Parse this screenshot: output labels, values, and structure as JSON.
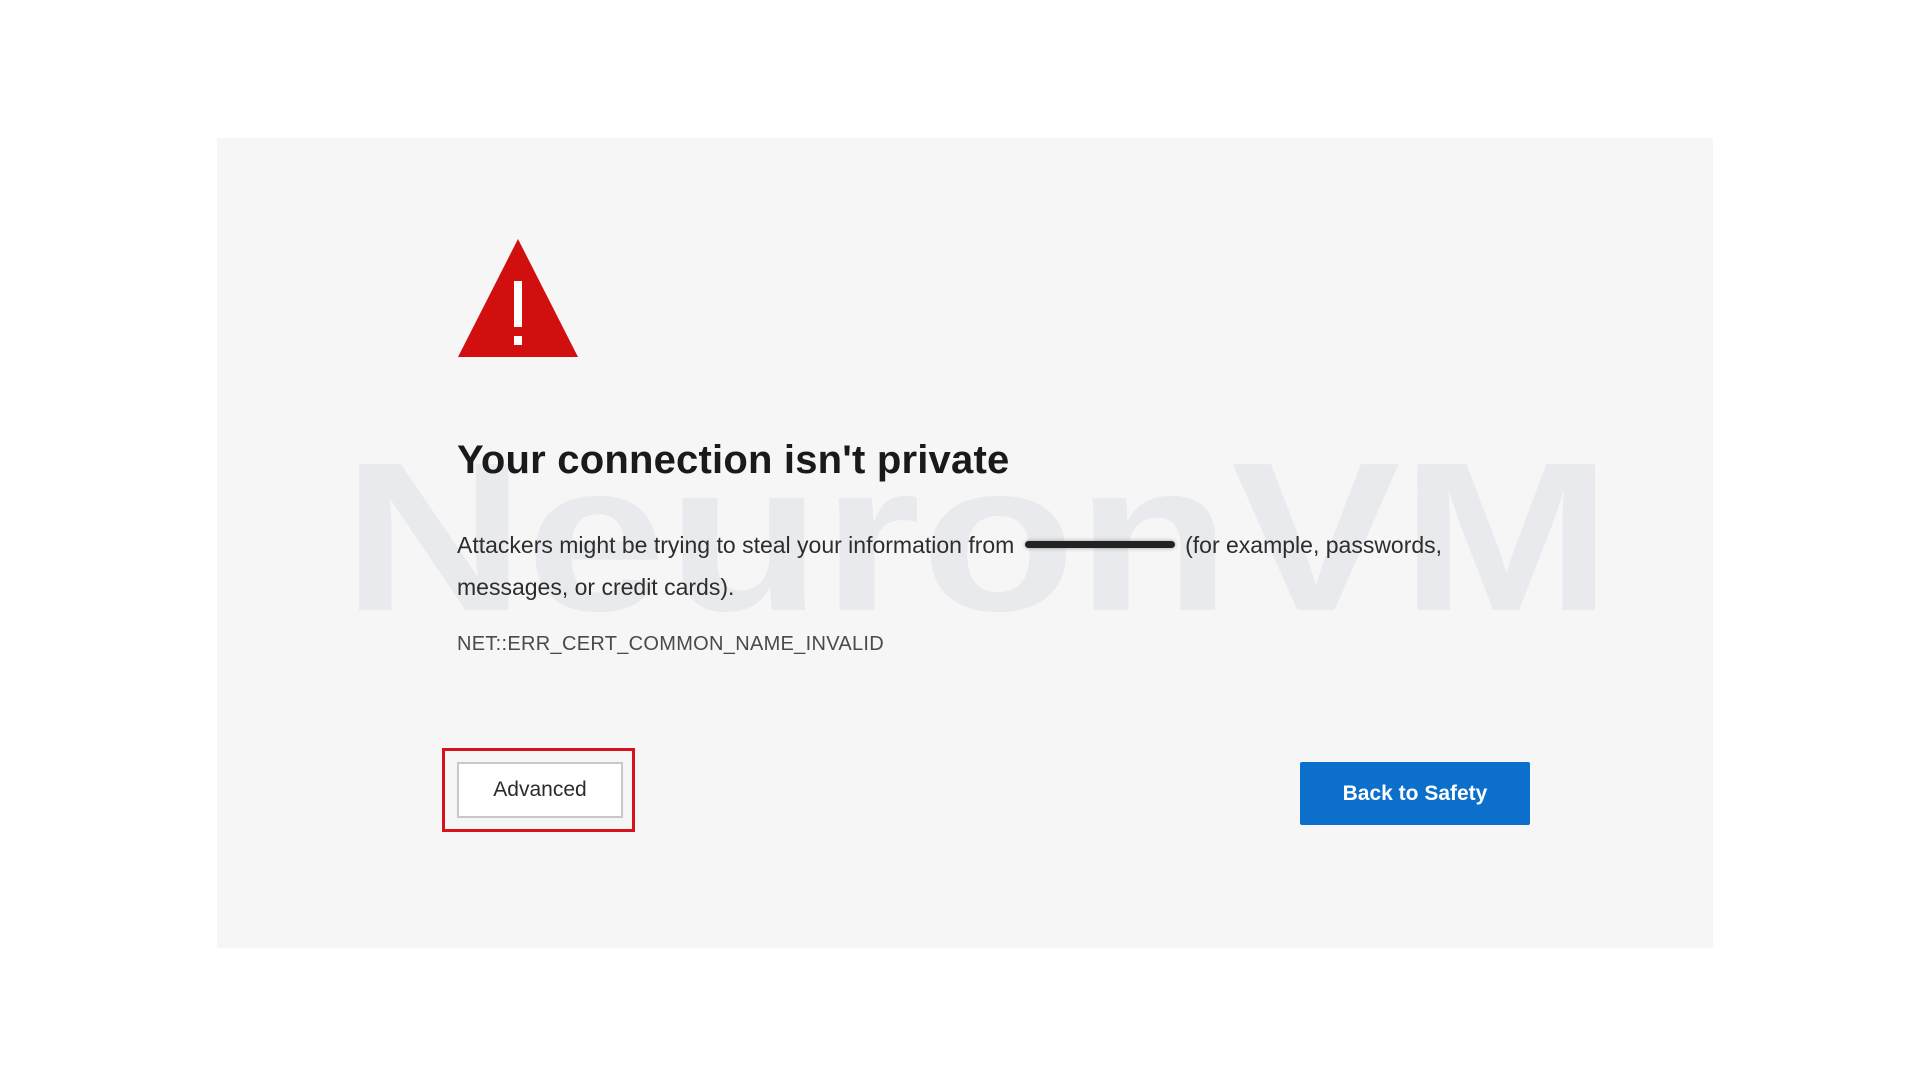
{
  "page": {
    "title": "Your connection isn't private",
    "message_before": "Attackers might be trying to steal your information from",
    "message_after": "(for example, passwords, messages, or credit cards).",
    "error_code": "NET::ERR_CERT_COMMON_NAME_INVALID"
  },
  "actions": {
    "advanced_label": "Advanced",
    "back_label": "Back to Safety"
  },
  "watermark": {
    "text": "NeuronVM"
  },
  "icons": {
    "warning": "warning-triangle-icon"
  },
  "colors": {
    "warning_red": "#d20f0f",
    "highlight_red": "#d8121c",
    "primary_blue": "#0b6fcb",
    "panel_bg": "#f6f6f6"
  }
}
